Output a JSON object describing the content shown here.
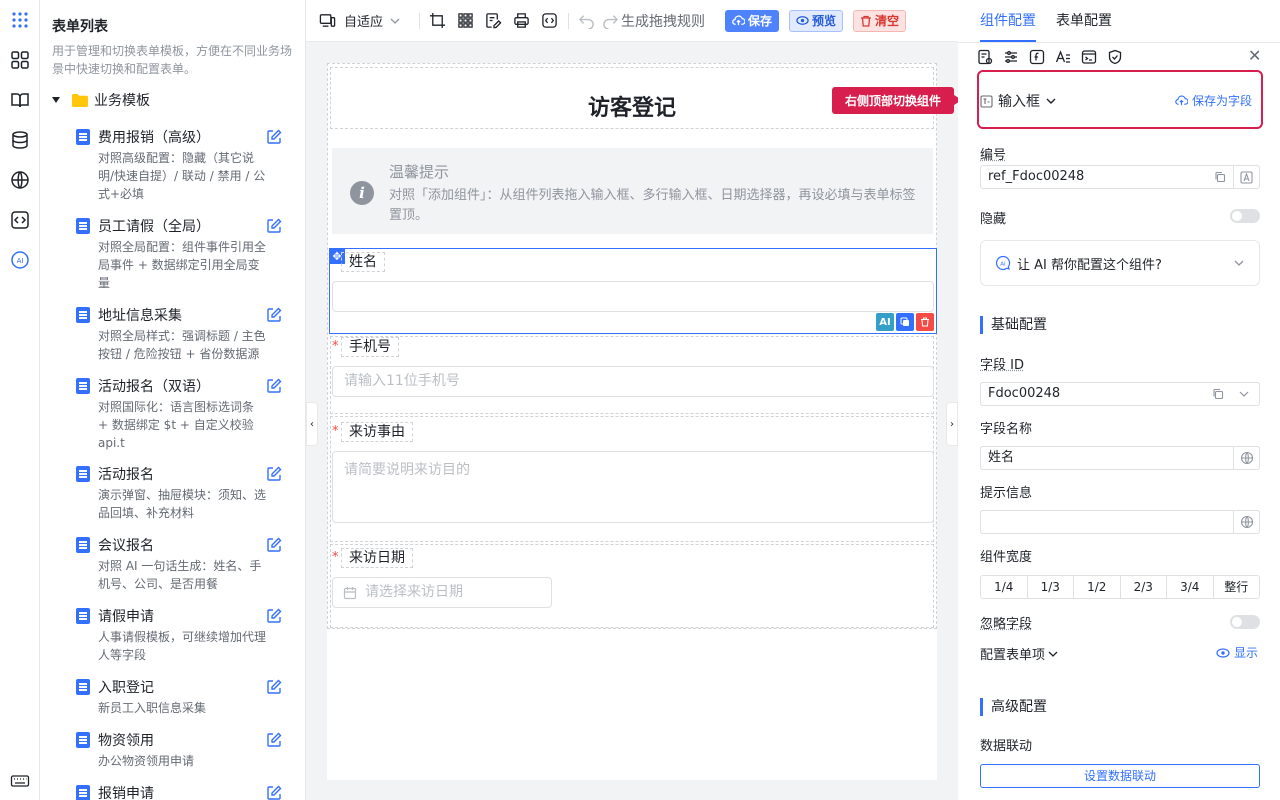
{
  "rail": {
    "icons": [
      "apps-icon",
      "layout-grid-icon",
      "book-icon",
      "database-icon",
      "globe-icon",
      "code-icon",
      "ai-icon",
      "keyboard-icon"
    ],
    "ai_label": "AI"
  },
  "list": {
    "title": "表单列表",
    "description": "用于管理和切换表单模板，方便在不同业务场景中快速切换和配置表单。",
    "group": "业务模板",
    "items": [
      {
        "name": "费用报销（高级）",
        "desc": "对照高级配置：隐藏（其它说明/快速自提）/ 联动 / 禁用 / 公式+必填"
      },
      {
        "name": "员工请假（全局）",
        "desc": "对照全局配置：组件事件引用全局事件 + 数据绑定引用全局变量"
      },
      {
        "name": "地址信息采集",
        "desc": "对照全局样式：强调标题 / 主色按钮 / 危险按钮 + 省份数据源"
      },
      {
        "name": "活动报名（双语）",
        "desc": "对照国际化：语言图标选词条 + 数据绑定 $t + 自定义校验 api.t"
      },
      {
        "name": "活动报名",
        "desc": "演示弹窗、抽屉模块：须知、选品回填、补充材料"
      },
      {
        "name": "会议报名",
        "desc": "对照 AI 一句话生成：姓名、手机号、公司、是否用餐"
      },
      {
        "name": "请假申请",
        "desc": "人事请假模板，可继续增加代理人等字段"
      },
      {
        "name": "入职登记",
        "desc": "新员工入职信息采集"
      },
      {
        "name": "物资领用",
        "desc": "办公物资领用申请"
      },
      {
        "name": "报销申请",
        "desc": ""
      }
    ]
  },
  "toolbar": {
    "adapt_label": "自适应",
    "gen_rules": "生成拖拽规则",
    "save": "保存",
    "preview": "预览",
    "clear": "清空"
  },
  "form": {
    "title": "访客登记",
    "tip_title": "温馨提示",
    "tip_body": "对照「添加组件」：从组件列表拖入输入框、多行输入框、日期选择器，再设必填与表单标签置顶。",
    "fields": [
      {
        "label": "姓名",
        "placeholder": "",
        "required": false
      },
      {
        "label": "手机号",
        "placeholder": "请输入11位手机号",
        "required": true
      },
      {
        "label": "来访事由",
        "placeholder": "请简要说明来访目的",
        "required": true
      },
      {
        "label": "来访日期",
        "placeholder": "请选择来访日期",
        "required": true
      }
    ],
    "required_mark": "*"
  },
  "config": {
    "tabs": [
      "组件配置",
      "表单配置"
    ],
    "component_type": "输入框",
    "save_as_field": "保存为字段",
    "callout": "右侧顶部切换组件",
    "id_label": "编号",
    "id_value": "ref_Fdoc00248",
    "hidden_label": "隐藏",
    "ai_prompt": "让 AI 帮你配置这个组件?",
    "basic_section": "基础配置",
    "field_id_label": "字段 ID",
    "field_id_value": "Fdoc00248",
    "field_name_label": "字段名称",
    "field_name_value": "姓名",
    "hint_label": "提示信息",
    "hint_value": "",
    "width_label": "组件宽度",
    "width_options": [
      "1/4",
      "1/3",
      "1/2",
      "2/3",
      "3/4",
      "整行"
    ],
    "ignore_label": "忽略字段",
    "form_items_label": "配置表单项",
    "show_label": "显示",
    "advanced_section": "高级配置",
    "linkage_label": "数据联动",
    "linkage_button": "设置数据联动"
  }
}
